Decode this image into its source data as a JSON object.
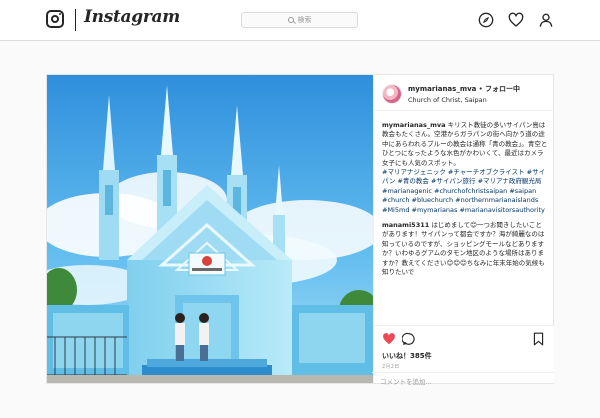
{
  "nav": {
    "logo_text": "Instagram",
    "search_placeholder": "検索"
  },
  "post": {
    "username": "mymarianas_mva",
    "separator": "•",
    "follow_label": "フォロー中",
    "location": "Church of Christ, Saipan",
    "caption_user": "mymarianas_mva",
    "caption_text": "キリスト教徒の多いサイパン島は教会もたくさん。空港からガラパンの街へ向かう道の途中にあらわれるブルーの教会は通称「青の教会」。青空とひとつになったような水色がかわいくて、最近はカメラ女子にも人気のスポット。",
    "hashtags": "#マリアナジェニック #チャーチオブクライスト #サイパン #青の教会 #サイパン旅行 #マリアナ政府観光局 #marianagenic #churchofchristsaipan #saipan #church #bluechurch #northernmarianaislands #Mi5md #mymarianas #marianavisitorsauthority",
    "comment_user": "manami5311",
    "comment_text": "はじめまして😊一つお聞きしたいことがあります！サイパンって都会ですか？海が綺麗なのは知っているのですが、ショッピングモールなどありますか？いわゆるグアムのタモン地区のような場所はありますか？教えてください😊😊😊ちなみに年末年始の気候も知りたいで",
    "likes": "いいね！385件",
    "date": "2月2日",
    "comment_placeholder": "コメントを追加..."
  },
  "colors": {
    "sky": "#3fa9e8",
    "church": "#8fd6f0",
    "link": "#003569",
    "like_red": "#ed4956"
  }
}
